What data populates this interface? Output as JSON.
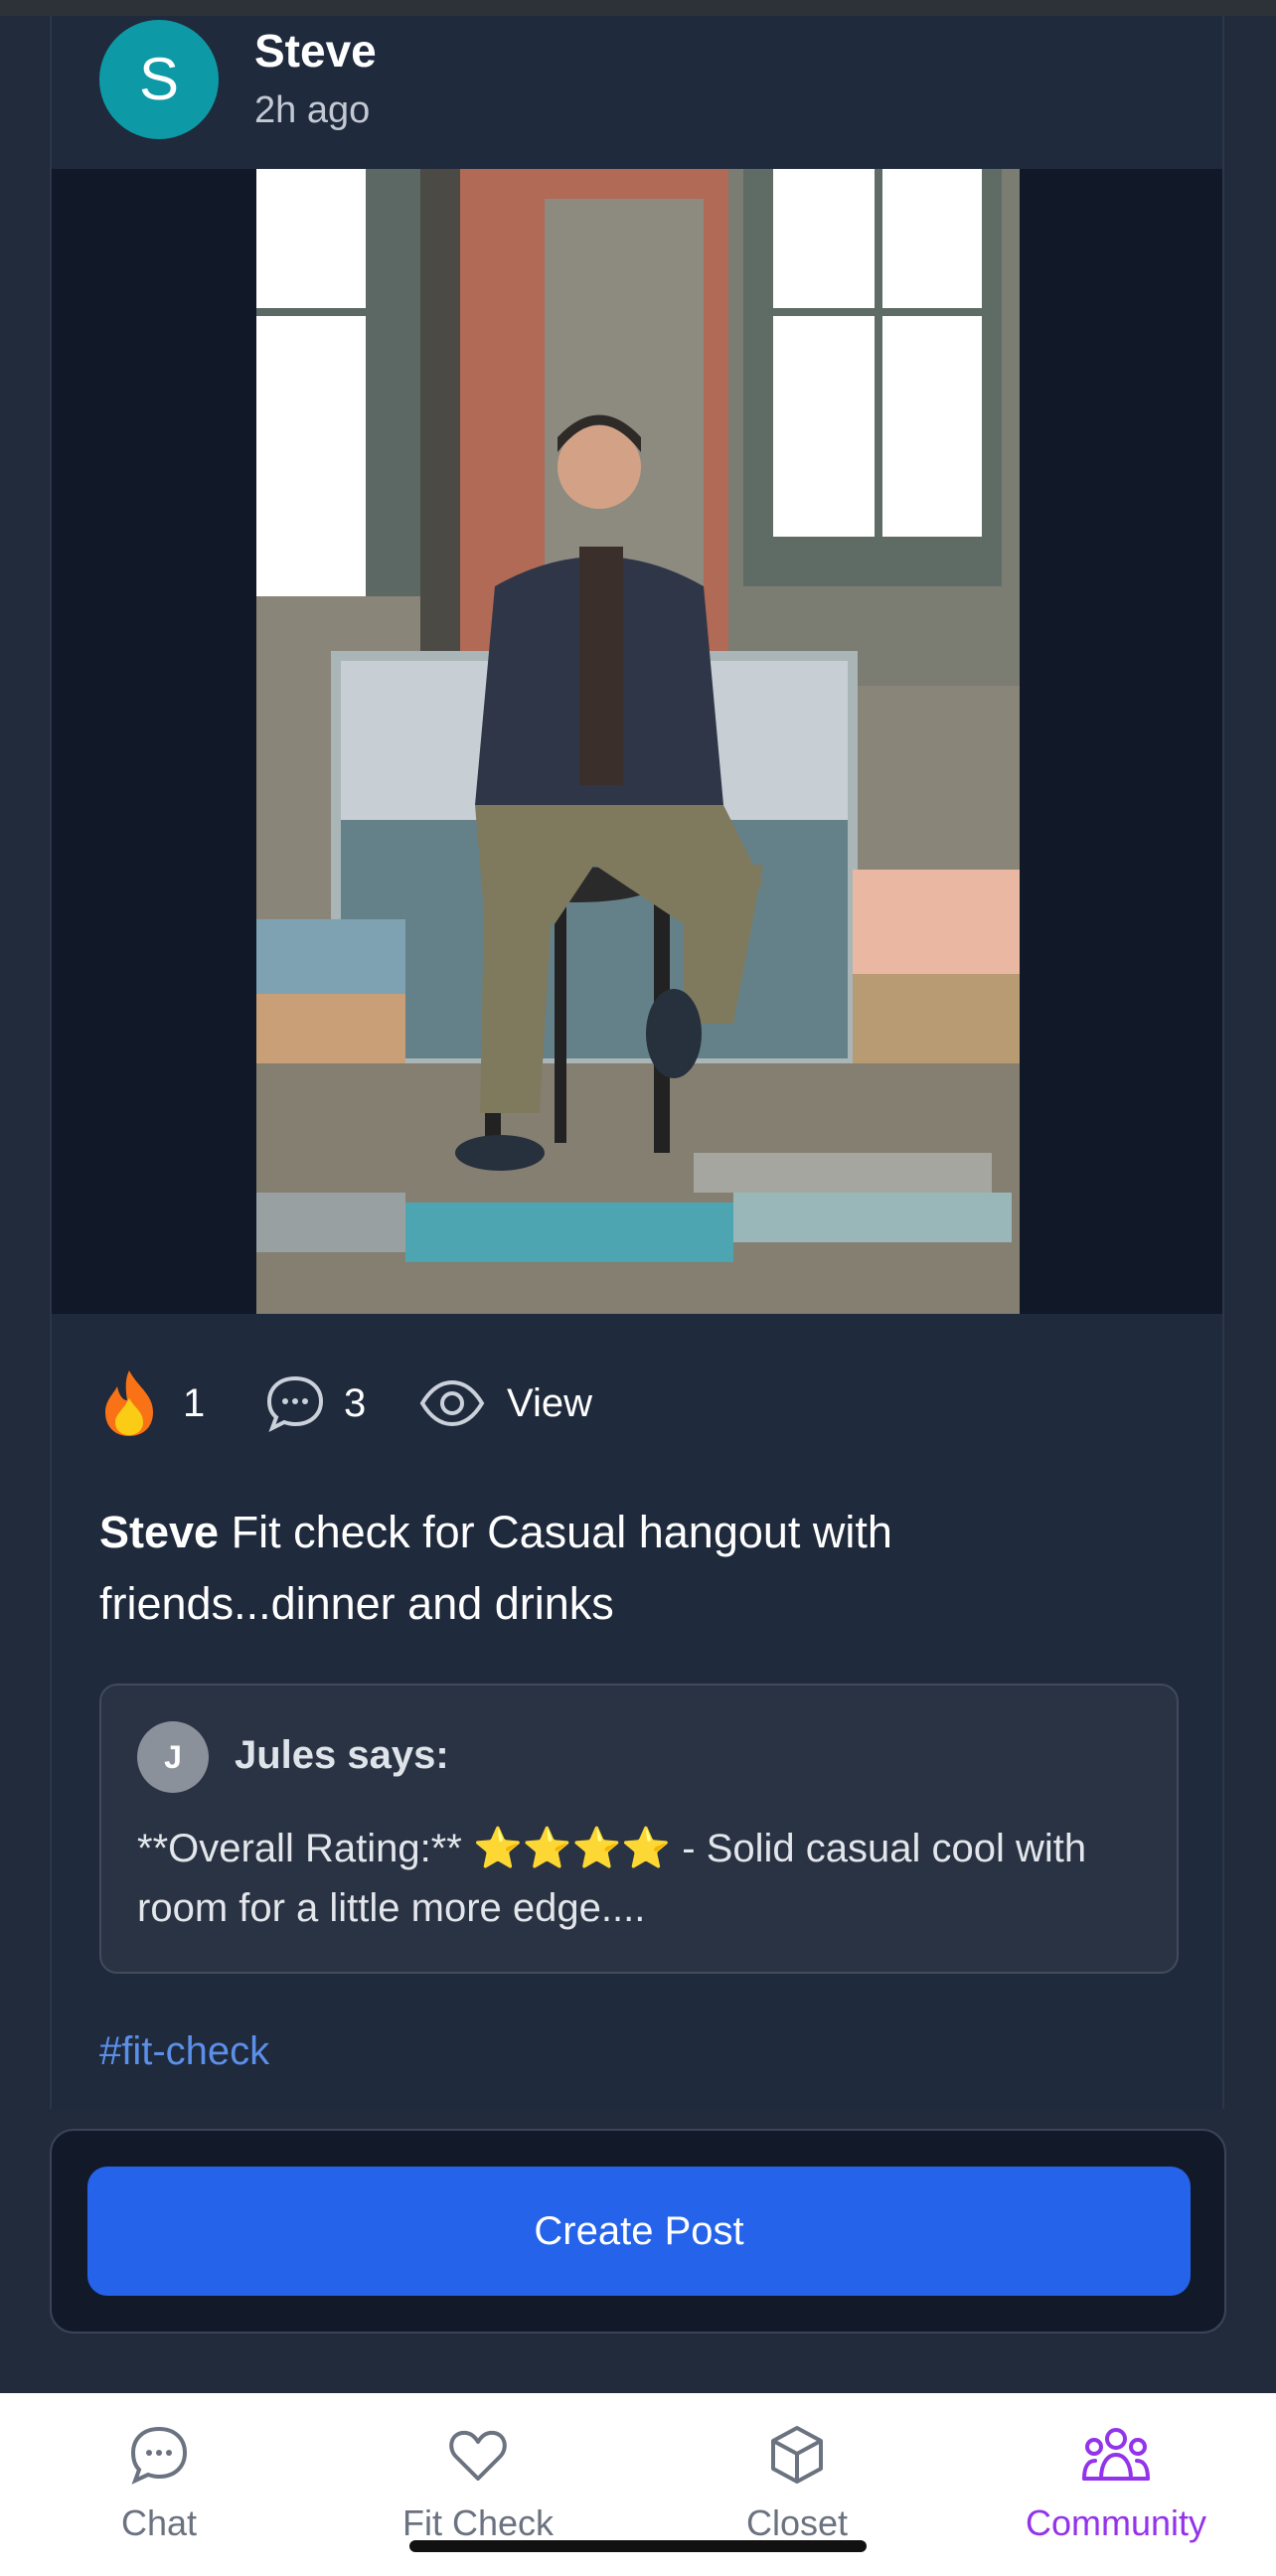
{
  "post": {
    "avatar_initial": "S",
    "author": "Steve",
    "time": "2h ago",
    "reactions": {
      "fire_count": "1",
      "comment_count": "3",
      "view_label": "View"
    },
    "caption_author": "Steve",
    "caption_text": " Fit check for Casual hangout with friends...dinner and drinks",
    "ai_review": {
      "avatar_initial": "J",
      "name": "Jules says:",
      "text_before": "**Overall Rating:** ",
      "stars": "⭐⭐⭐⭐",
      "text_after": " - Solid casual cool with room for a little more edge...."
    },
    "hashtag": "#fit-check"
  },
  "create_post_label": "Create Post",
  "bottom_nav": {
    "items": [
      {
        "label": "Chat",
        "icon": "chat-bubble-icon"
      },
      {
        "label": "Fit Check",
        "icon": "heart-icon"
      },
      {
        "label": "Closet",
        "icon": "box-icon"
      },
      {
        "label": "Community",
        "icon": "community-icon",
        "active": true
      }
    ]
  },
  "colors": {
    "accent": "#2563eb",
    "active_nav": "#9333ea",
    "avatar": "#0d9aa6",
    "hashtag": "#5b8fe8"
  }
}
